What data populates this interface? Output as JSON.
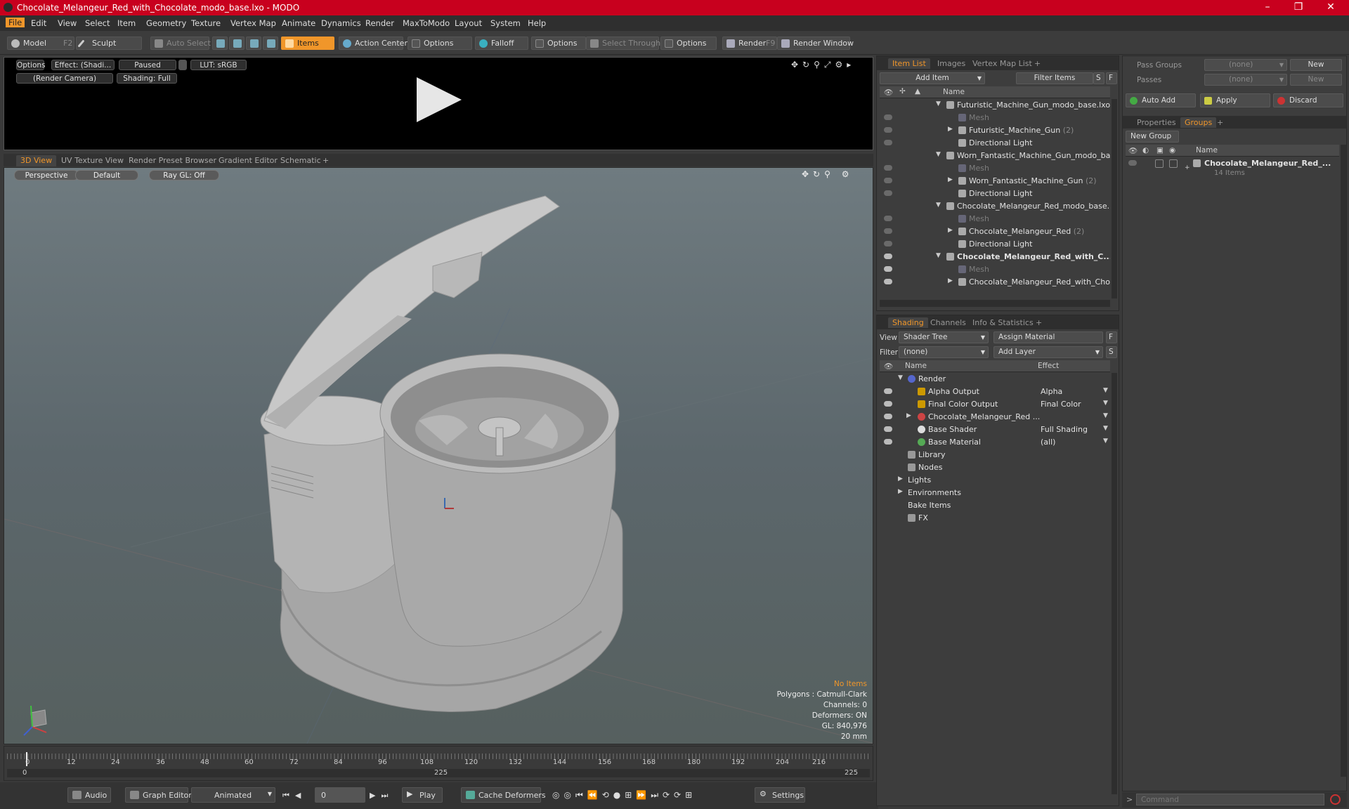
{
  "window": {
    "title": "Chocolate_Melangeur_Red_with_Chocolate_modo_base.lxo - MODO"
  },
  "menu": [
    "File",
    "Edit",
    "View",
    "Select",
    "Item",
    "Geometry",
    "Texture",
    "Vertex Map",
    "Animate",
    "Dynamics",
    "Render",
    "MaxToModo",
    "Layout",
    "System",
    "Help"
  ],
  "toolbar": {
    "model": "Model",
    "model_key": "F2",
    "sculpt": "Sculpt",
    "auto_select": "Auto Select",
    "items": "Items",
    "action_center": "Action Center",
    "options1": "Options",
    "falloff": "Falloff",
    "options2": "Options",
    "select_through": "Select Through",
    "options3": "Options",
    "render": "Render",
    "render_key": "F9",
    "render_window": "Render Window"
  },
  "preview": {
    "options": "Options",
    "effect": "Effect: (Shadi...",
    "paused": "Paused",
    "lut": "LUT: sRGB",
    "camera": "(Render Camera)",
    "shading": "Shading: Full"
  },
  "viewport_tabs": [
    "3D View",
    "UV Texture View",
    "Render Preset Browser",
    "Gradient Editor",
    "Schematic",
    "+"
  ],
  "viewport": {
    "perspective": "Perspective",
    "default": "Default",
    "raygl": "Ray GL: Off",
    "stats": [
      "No Items",
      "Polygons : Catmull-Clark",
      "Channels: 0",
      "Deformers: ON",
      "GL: 840,976",
      "20 mm"
    ]
  },
  "timeline": {
    "ticks": [
      "0",
      "12",
      "24",
      "36",
      "48",
      "60",
      "72",
      "84",
      "96",
      "108",
      "120",
      "132",
      "144",
      "156",
      "168",
      "180",
      "192",
      "204",
      "216"
    ],
    "range_start": "0",
    "range_mid": "225",
    "range_end": "225"
  },
  "bottombar": {
    "audio": "Audio",
    "graph_editor": "Graph Editor",
    "animated": "Animated",
    "frame": "0",
    "play": "Play",
    "cache": "Cache Deformers",
    "settings": "Settings"
  },
  "item_list": {
    "tabs": [
      "Item List",
      "Images",
      "Vertex Map List",
      "+"
    ],
    "add_item": "Add Item",
    "filter": "Filter Items",
    "s": "S",
    "f": "F",
    "col_name": "Name",
    "rows": [
      {
        "label": "Futuristic_Machine_Gun_modo_base.lxo",
        "count": ""
      },
      {
        "label": "Mesh",
        "count": ""
      },
      {
        "label": "Futuristic_Machine_Gun",
        "count": "(2)"
      },
      {
        "label": "Directional Light",
        "count": ""
      },
      {
        "label": "Worn_Fantastic_Machine_Gun_modo_ba ...",
        "count": ""
      },
      {
        "label": "Mesh",
        "count": ""
      },
      {
        "label": "Worn_Fantastic_Machine_Gun",
        "count": "(2)"
      },
      {
        "label": "Directional Light",
        "count": ""
      },
      {
        "label": "Chocolate_Melangeur_Red_modo_base.lxo",
        "count": ""
      },
      {
        "label": "Mesh",
        "count": ""
      },
      {
        "label": "Chocolate_Melangeur_Red",
        "count": "(2)"
      },
      {
        "label": "Directional Light",
        "count": ""
      },
      {
        "label": "Chocolate_Melangeur_Red_with_C...",
        "count": ""
      },
      {
        "label": "Mesh",
        "count": ""
      },
      {
        "label": "Chocolate_Melangeur_Red_with_Choc...",
        "count": ""
      }
    ]
  },
  "shading": {
    "tabs": [
      "Shading",
      "Channels",
      "Info & Statistics",
      "+"
    ],
    "view_label": "View",
    "view_value": "Shader Tree",
    "assign": "Assign Material",
    "f": "F",
    "filter_label": "Filter",
    "filter_value": "(none)",
    "add_layer": "Add Layer",
    "s": "S",
    "col_name": "Name",
    "col_effect": "Effect",
    "rows": [
      {
        "label": "Render",
        "effect": ""
      },
      {
        "label": "Alpha Output",
        "effect": "Alpha"
      },
      {
        "label": "Final Color Output",
        "effect": "Final Color"
      },
      {
        "label": "Chocolate_Melangeur_Red ...",
        "effect": ""
      },
      {
        "label": "Base Shader",
        "effect": "Full Shading"
      },
      {
        "label": "Base Material",
        "effect": "(all)"
      },
      {
        "label": "Library",
        "effect": ""
      },
      {
        "label": "Nodes",
        "effect": ""
      },
      {
        "label": "Lights",
        "effect": ""
      },
      {
        "label": "Environments",
        "effect": ""
      },
      {
        "label": "Bake Items",
        "effect": ""
      },
      {
        "label": "FX",
        "effect": ""
      }
    ]
  },
  "groups": {
    "pass_groups": "Pass Groups",
    "passes": "Passes",
    "none1": "(none)",
    "none2": "(none)",
    "new1": "New",
    "new2": "New",
    "auto_add": "Auto Add",
    "apply": "Apply",
    "discard": "Discard",
    "tabs": [
      "Properties",
      "Groups",
      "+"
    ],
    "new_group": "New Group",
    "col_name": "Name",
    "item_name": "Chocolate_Melangeur_Red_...",
    "item_count": "14 Items"
  },
  "command": {
    "placeholder": "Command"
  },
  "colors": {
    "accent": "#f0962a",
    "titlebar": "#c8001e"
  }
}
